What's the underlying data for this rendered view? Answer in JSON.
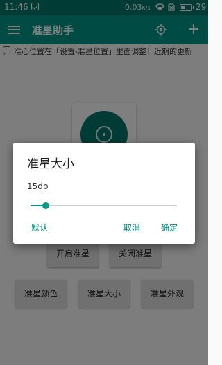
{
  "status_bar": {
    "time": "11:46",
    "network_speed": "0.03",
    "network_unit": "K/s",
    "battery": "29"
  },
  "toolbar": {
    "title": "准星助手",
    "icons": [
      "menu-icon",
      "locate-icon",
      "add-icon"
    ]
  },
  "marquee": {
    "text": "准心位置在「设置-准星位置」里面调整！近期的更新"
  },
  "preview": {
    "color": "#00796b"
  },
  "buttons": {
    "open": "开启准星",
    "close": "关闭准星",
    "color": "准星颜色",
    "size": "准星大小",
    "look": "准星外观"
  },
  "dialog": {
    "title": "准星大小",
    "value_label": "15dp",
    "slider_fraction": 0.1,
    "default_label": "默认",
    "cancel_label": "取消",
    "ok_label": "确定"
  },
  "colors": {
    "primary": "#009688",
    "primary_dark": "#00796b",
    "accent": "#00897b"
  }
}
